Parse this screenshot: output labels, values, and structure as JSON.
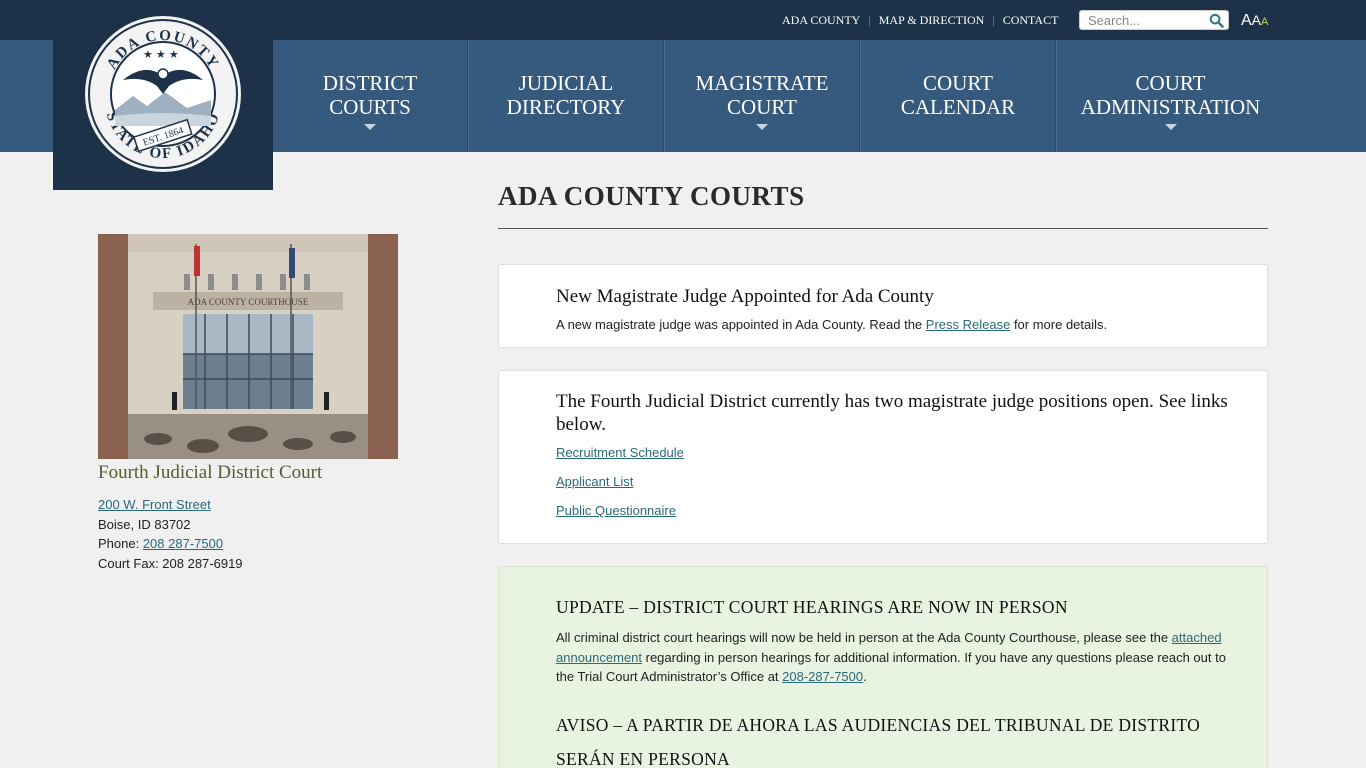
{
  "header": {
    "top_links": [
      "ADA COUNTY",
      "MAP & DIRECTION",
      "CONTACT"
    ],
    "search_placeholder": "Search...",
    "font_size_controls": [
      "A",
      "A",
      "A"
    ],
    "logo": {
      "top_text": "ADA COUNTY",
      "bottom_text": "STATE OF IDAHO",
      "banner": "EST. 1864"
    }
  },
  "nav": {
    "items": [
      {
        "line1": "DISTRICT",
        "line2": "COURTS",
        "has_dropdown": true
      },
      {
        "line1": "JUDICIAL",
        "line2": "DIRECTORY",
        "has_dropdown": false
      },
      {
        "line1": "MAGISTRATE",
        "line2": "COURT",
        "has_dropdown": true
      },
      {
        "line1": "COURT",
        "line2": "CALENDAR",
        "has_dropdown": false
      },
      {
        "line1": "COURT",
        "line2": "ADMINISTRATION",
        "has_dropdown": true
      }
    ]
  },
  "sidebar": {
    "photo_sign": "ADA COUNTY COURTHOUSE",
    "court_name": "Fourth Judicial District Court",
    "street": "200 W. Front Street",
    "city": "Boise, ID 83702",
    "phone_label": "Phone: ",
    "phone": "208 287-7500",
    "fax": "Court Fax: 208 287-6919"
  },
  "main": {
    "page_title": "ADA COUNTY COURTS",
    "cards": [
      {
        "title": "New Magistrate Judge Appointed for Ada County",
        "text_before": "A new magistrate judge was appointed in Ada County. Read the ",
        "link": "Press Release",
        "text_after": " for more details."
      },
      {
        "title": "The Fourth Judicial District currently has two magistrate judge positions open. See links below.",
        "links": [
          "Recruitment Schedule",
          "Applicant List",
          "Public Questionnaire"
        ]
      },
      {
        "title": "UPDATE – DISTRICT COURT HEARINGS ARE NOW IN PERSON",
        "text_1": "All criminal district court hearings will now be held in person at the Ada County Courthouse, please see the ",
        "link_1": "attached announcement",
        "text_2": " regarding in person hearings for additional information. If you have any questions please reach out to the Trial Court Administrator’s Office at ",
        "link_2": "208-287-7500",
        "text_3": ".",
        "title_es": "AVISO – A PARTIR DE AHORA LAS AUDIENCIAS DEL TRIBUNAL DE DISTRITO SERÁN EN PERSONA",
        "background": "#e9f3e1"
      }
    ]
  },
  "colors": {
    "topbar": "#1d3249",
    "navbar": "#365a7d",
    "link": "#2a6a7a",
    "court_name": "#5a5a2e",
    "font_size_accent": "#c8d84a"
  }
}
